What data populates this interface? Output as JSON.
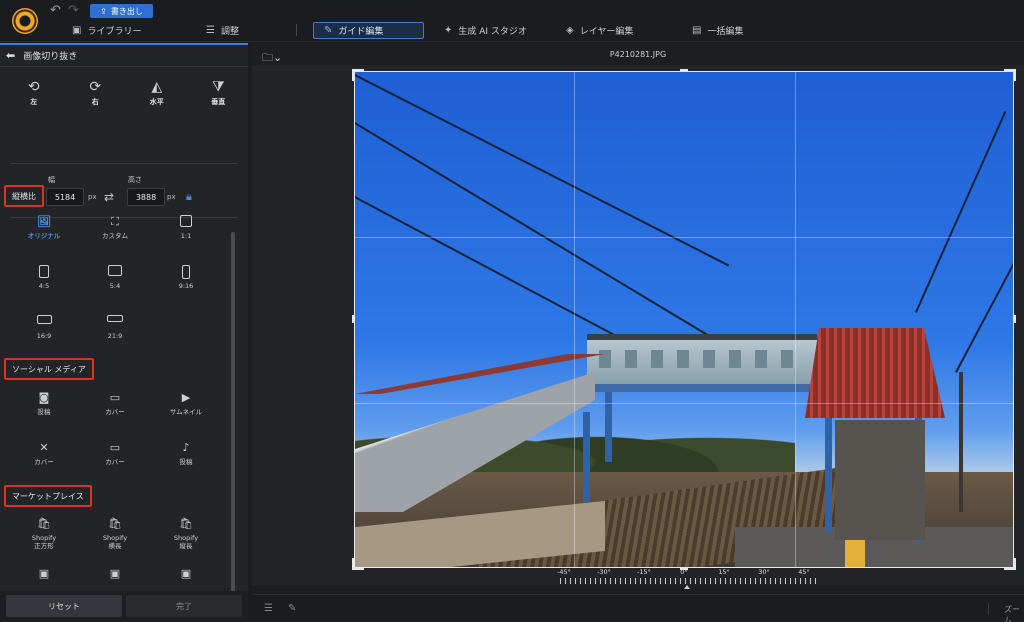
{
  "toolbar": {
    "export_label": "書き出し",
    "undo_icon": "undo-icon",
    "redo_icon": "redo-icon"
  },
  "nav": {
    "tabs": [
      {
        "label": "ライブラリー",
        "icon": "library-icon"
      },
      {
        "label": "調整",
        "icon": "sliders-icon"
      },
      {
        "label": "ガイド編集",
        "icon": "magic-wand-icon",
        "active": true
      },
      {
        "label": "生成 AI スタジオ",
        "icon": "sparkle-icon"
      },
      {
        "label": "レイヤー編集",
        "icon": "layers-icon"
      },
      {
        "label": "一括編集",
        "icon": "batch-icon"
      }
    ]
  },
  "panel": {
    "title": "画像切り抜き",
    "rotate": [
      {
        "label": "左",
        "icon": "rotate-left-icon"
      },
      {
        "label": "右",
        "icon": "rotate-right-icon"
      },
      {
        "label": "水平",
        "icon": "flip-horizontal-icon"
      },
      {
        "label": "垂直",
        "icon": "flip-vertical-icon"
      }
    ],
    "size": {
      "width_label": "幅",
      "height_label": "高さ",
      "width": "5184",
      "height": "3888",
      "unit": "px"
    },
    "aspect_section": "縦横比",
    "aspect": [
      {
        "label": "オリジナル",
        "selected": true
      },
      {
        "label": "カスタム"
      },
      {
        "label": "1:1"
      },
      {
        "label": "4:5"
      },
      {
        "label": "5:4"
      },
      {
        "label": "9:16"
      },
      {
        "label": "16:9"
      },
      {
        "label": "21:9"
      }
    ],
    "social_section": "ソーシャル メディア",
    "social": [
      {
        "label": "投稿",
        "icon": "instagram-icon"
      },
      {
        "label": "カバー",
        "icon": "facebook-icon"
      },
      {
        "label": "サムネイル",
        "icon": "youtube-icon"
      },
      {
        "label": "カバー",
        "icon": "twitter-icon"
      },
      {
        "label": "カバー",
        "icon": "linkedin-icon"
      },
      {
        "label": "投稿",
        "icon": "tiktok-icon"
      }
    ],
    "market_section": "マーケットプレイス",
    "market": [
      {
        "label": "Shopify\n正方形",
        "icon": "shopify-icon"
      },
      {
        "label": "Shopify\n横長",
        "icon": "shopify-icon"
      },
      {
        "label": "Shopify\n縦長",
        "icon": "shopify-icon"
      }
    ],
    "reset_label": "リセット",
    "done_label": "完了"
  },
  "canvas": {
    "filename": "P4210281.JPG",
    "angle_labels": [
      "-45°",
      "-30°",
      "-15°",
      "0°",
      "15°",
      "30°",
      "45°"
    ],
    "zoom_label": "ズーム"
  },
  "colors": {
    "accent": "#3b7ddd",
    "highlight": "#e0301e",
    "selected_text": "#4a90e2"
  }
}
